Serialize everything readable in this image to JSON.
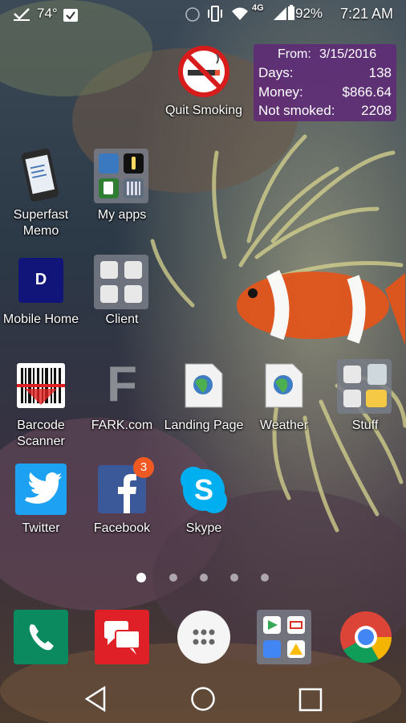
{
  "status_bar": {
    "temperature": "74°",
    "network": "4G",
    "battery": "92%",
    "time": "7:21 AM"
  },
  "widget": {
    "from_label": "From:",
    "from_date": "3/15/2016",
    "days_label": "Days:",
    "days_value": "138",
    "money_label": "Money:",
    "money_value": "$866.64",
    "not_smoked_label": "Not smoked:",
    "not_smoked_value": "2208"
  },
  "apps": {
    "quit_smoking": "Quit Smoking",
    "superfast_memo": "Superfast Memo",
    "my_apps": "My apps",
    "d_icon_letter": "D",
    "mobile_home": "Mobile Home",
    "client": "Client",
    "barcode_scanner": "Barcode Scanner",
    "fark_letter": "F",
    "fark": "FARK.com",
    "landing_page": "Landing Page",
    "weather": "Weather",
    "stuff": "Stuff",
    "twitter": "Twitter",
    "facebook": "Facebook",
    "facebook_badge": "3",
    "skype": "Skype"
  },
  "colors": {
    "widget_bg": "#5f2878",
    "phone_green": "#0b8a5f",
    "messages_red": "#e02027",
    "twitter_blue": "#1da1f2",
    "facebook_blue": "#3b5998",
    "skype_blue": "#00aff0",
    "badge_orange": "#f05a22"
  },
  "page_indicator": {
    "pages": 5,
    "current": 1
  },
  "dock": [
    "phone-icon",
    "messages-icon",
    "app-drawer-icon",
    "google-folder-icon",
    "chrome-icon"
  ],
  "nav": [
    "back-icon",
    "home-icon",
    "recents-icon"
  ]
}
